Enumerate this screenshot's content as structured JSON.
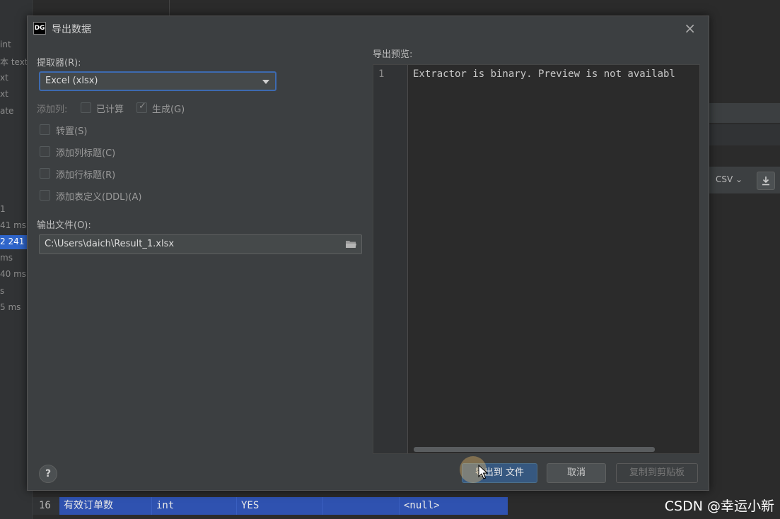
{
  "background": {
    "left_fragments": [
      "int",
      "本 text",
      "xt",
      "xt",
      "ate",
      "1",
      "41 ms",
      "2 241",
      "ms",
      "40 ms",
      "s",
      "5 ms"
    ],
    "right": {
      "format": "CSV ⌄"
    },
    "table_row": {
      "num": "16",
      "name": "有效订单数",
      "type": "int",
      "nullable": "YES",
      "extra": "",
      "default": "<null>"
    },
    "watermark": "CSDN @幸运小新"
  },
  "dialog": {
    "icon_text": "DG",
    "title": "导出数据",
    "close": "×",
    "extractor_label": "提取器(R):",
    "extractor_value": "Excel (xlsx)",
    "add_columns_label": "添加列:",
    "computed_label": "已计算",
    "generated_label": "生成(G)",
    "options": [
      {
        "label": "转置(S)",
        "checked": false
      },
      {
        "label": "添加列标题(C)",
        "checked": false
      },
      {
        "label": "添加行标题(R)",
        "checked": false
      },
      {
        "label": "添加表定义(DDL)(A)",
        "checked": false
      }
    ],
    "output_label": "输出文件(O):",
    "output_value": "C:\\Users\\daich\\Result_1.xlsx",
    "preview_label": "导出预览:",
    "preview_line_no": "1",
    "preview_text": "Extractor is binary. Preview is not availabl",
    "help": "?",
    "buttons": {
      "export": "导出到 文件",
      "cancel": "取消",
      "copy": "复制到剪贴板"
    }
  },
  "colors": {
    "dialog_bg": "#3c3f41",
    "accent": "#365880",
    "selection": "#2f52b0"
  }
}
